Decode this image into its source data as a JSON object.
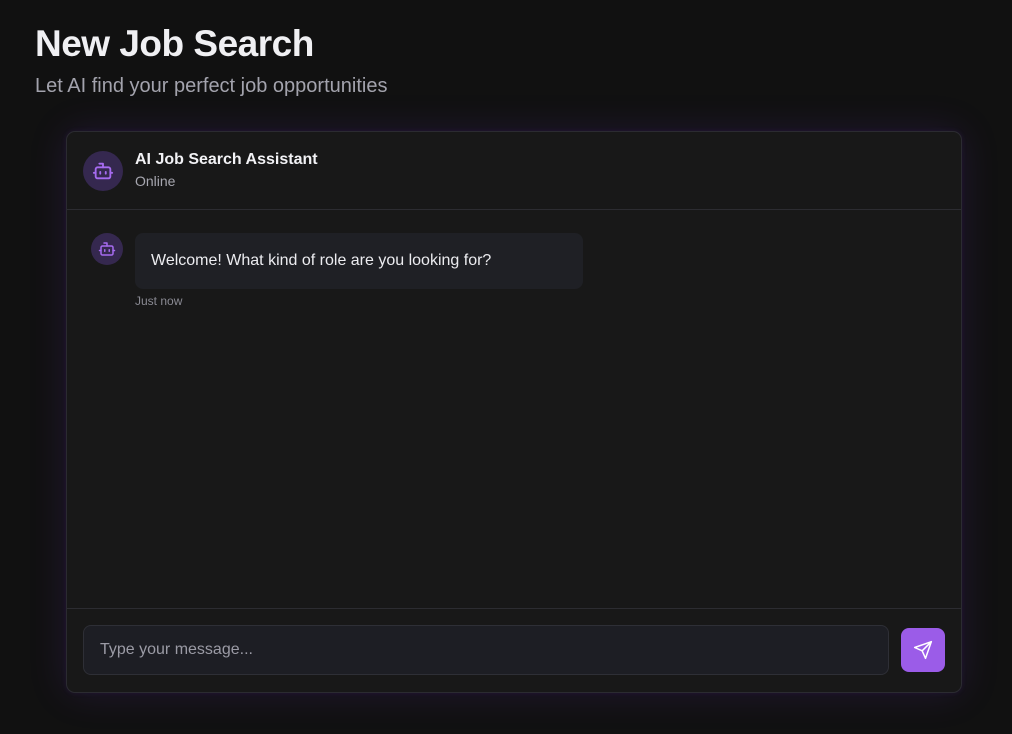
{
  "page": {
    "title": "New Job Search",
    "subtitle": "Let AI find your perfect job opportunities"
  },
  "chat": {
    "assistant_name": "AI Job Search Assistant",
    "status": "Online",
    "assistant_icon": "bot-icon",
    "messages": [
      {
        "sender": "assistant",
        "text": "Welcome! What kind of role are you looking for?",
        "time": "Just now"
      }
    ],
    "input": {
      "placeholder": "Type your message...",
      "value": ""
    },
    "send_icon": "send-icon"
  },
  "colors": {
    "accent": "#9b5ce8",
    "icon_purple": "#a66bf0",
    "avatar_bg": "#35284f",
    "background": "#111111",
    "card": "#181818"
  }
}
